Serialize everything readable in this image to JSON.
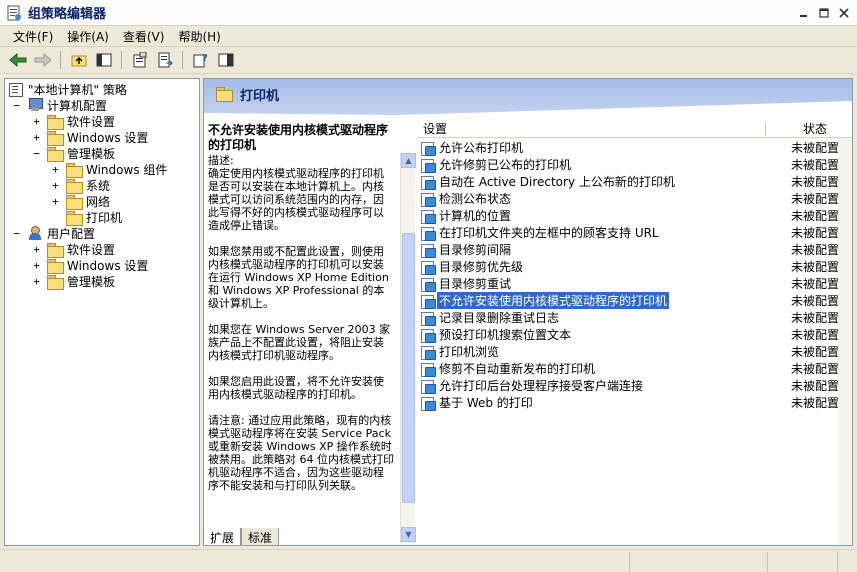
{
  "window": {
    "title": "组策略编辑器",
    "buttons": [
      "minimize",
      "maximize",
      "close"
    ]
  },
  "menu": [
    {
      "label": "文件(F)"
    },
    {
      "label": "操作(A)"
    },
    {
      "label": "查看(V)"
    },
    {
      "label": "帮助(H)"
    }
  ],
  "toolbar": {
    "icons": [
      "back-icon",
      "forward-icon",
      "up-folder-icon",
      "show-hide-tree-icon",
      "properties-icon",
      "export-list-icon",
      "help-icon",
      "console-tree-icon"
    ]
  },
  "tree": {
    "root": "\"本地计算机\" 策略",
    "computer": "计算机配置",
    "computer_software": "软件设置",
    "computer_windows": "Windows 设置",
    "computer_admin": "管理模板",
    "win_components": "Windows 组件",
    "system": "系统",
    "network": "网络",
    "printers": "打印机",
    "user": "用户配置",
    "user_software": "软件设置",
    "user_windows": "Windows 设置",
    "user_admin": "管理模板"
  },
  "banner": {
    "title": "打印机"
  },
  "description": {
    "title": "不允许安装使用内核模式驱动程序的打印机",
    "body": "描述:\n确定使用内核模式驱动程序的打印机是否可以安装在本地计算机上。内核模式可以访问系统范围内的内存，因此写得不好的内核模式驱动程序可以造成停止错误。\n\n如果您禁用或不配置此设置，则使用内核模式驱动程序的打印机可以安装在运行 Windows XP Home Edition 和 Windows XP Professional 的本级计算机上。\n\n如果您在 Windows Server 2003 家族产品上不配置此设置，将阻止安装内核模式打印机驱动程序。\n\n如果您启用此设置，将不允许安装使用内核模式驱动程序的打印机。\n\n请注意: 通过应用此策略，现有的内核模式驱动程序将在安装 Service Pack 或重新安装 Windows XP 操作系统时被禁用。此策略对 64 位内核模式打印机驱动程序不适合，因为这些驱动程序不能安装和与打印队列关联。"
  },
  "list": {
    "col_setting": "设置",
    "col_status": "状态",
    "rows": [
      {
        "name": "允许公布打印机",
        "status": "未被配置"
      },
      {
        "name": "允许修剪已公布的打印机",
        "status": "未被配置"
      },
      {
        "name": "自动在 Active Directory 上公布新的打印机",
        "status": "未被配置"
      },
      {
        "name": "检测公布状态",
        "status": "未被配置"
      },
      {
        "name": "计算机的位置",
        "status": "未被配置"
      },
      {
        "name": "在打印机文件夹的左框中的顾客支持 URL",
        "status": "未被配置"
      },
      {
        "name": "目录修剪间隔",
        "status": "未被配置"
      },
      {
        "name": "目录修剪优先级",
        "status": "未被配置"
      },
      {
        "name": "目录修剪重试",
        "status": "未被配置"
      },
      {
        "name": "不允许安装使用内核模式驱动程序的打印机",
        "status": "未被配置",
        "selected": true
      },
      {
        "name": "记录目录删除重试日志",
        "status": "未被配置"
      },
      {
        "name": "预设打印机搜索位置文本",
        "status": "未被配置"
      },
      {
        "name": "打印机浏览",
        "status": "未被配置"
      },
      {
        "name": "修剪不自动重新发布的打印机",
        "status": "未被配置"
      },
      {
        "name": "允许打印后台处理程序接受客户端连接",
        "status": "未被配置"
      },
      {
        "name": "基于 Web 的打印",
        "status": "未被配置"
      }
    ]
  },
  "tabs": {
    "extended": "扩展",
    "standard": "标准"
  },
  "colors": {
    "selection": "#316AC5",
    "banner_top": "#A3BBE7",
    "title_text": "#0A246A"
  }
}
